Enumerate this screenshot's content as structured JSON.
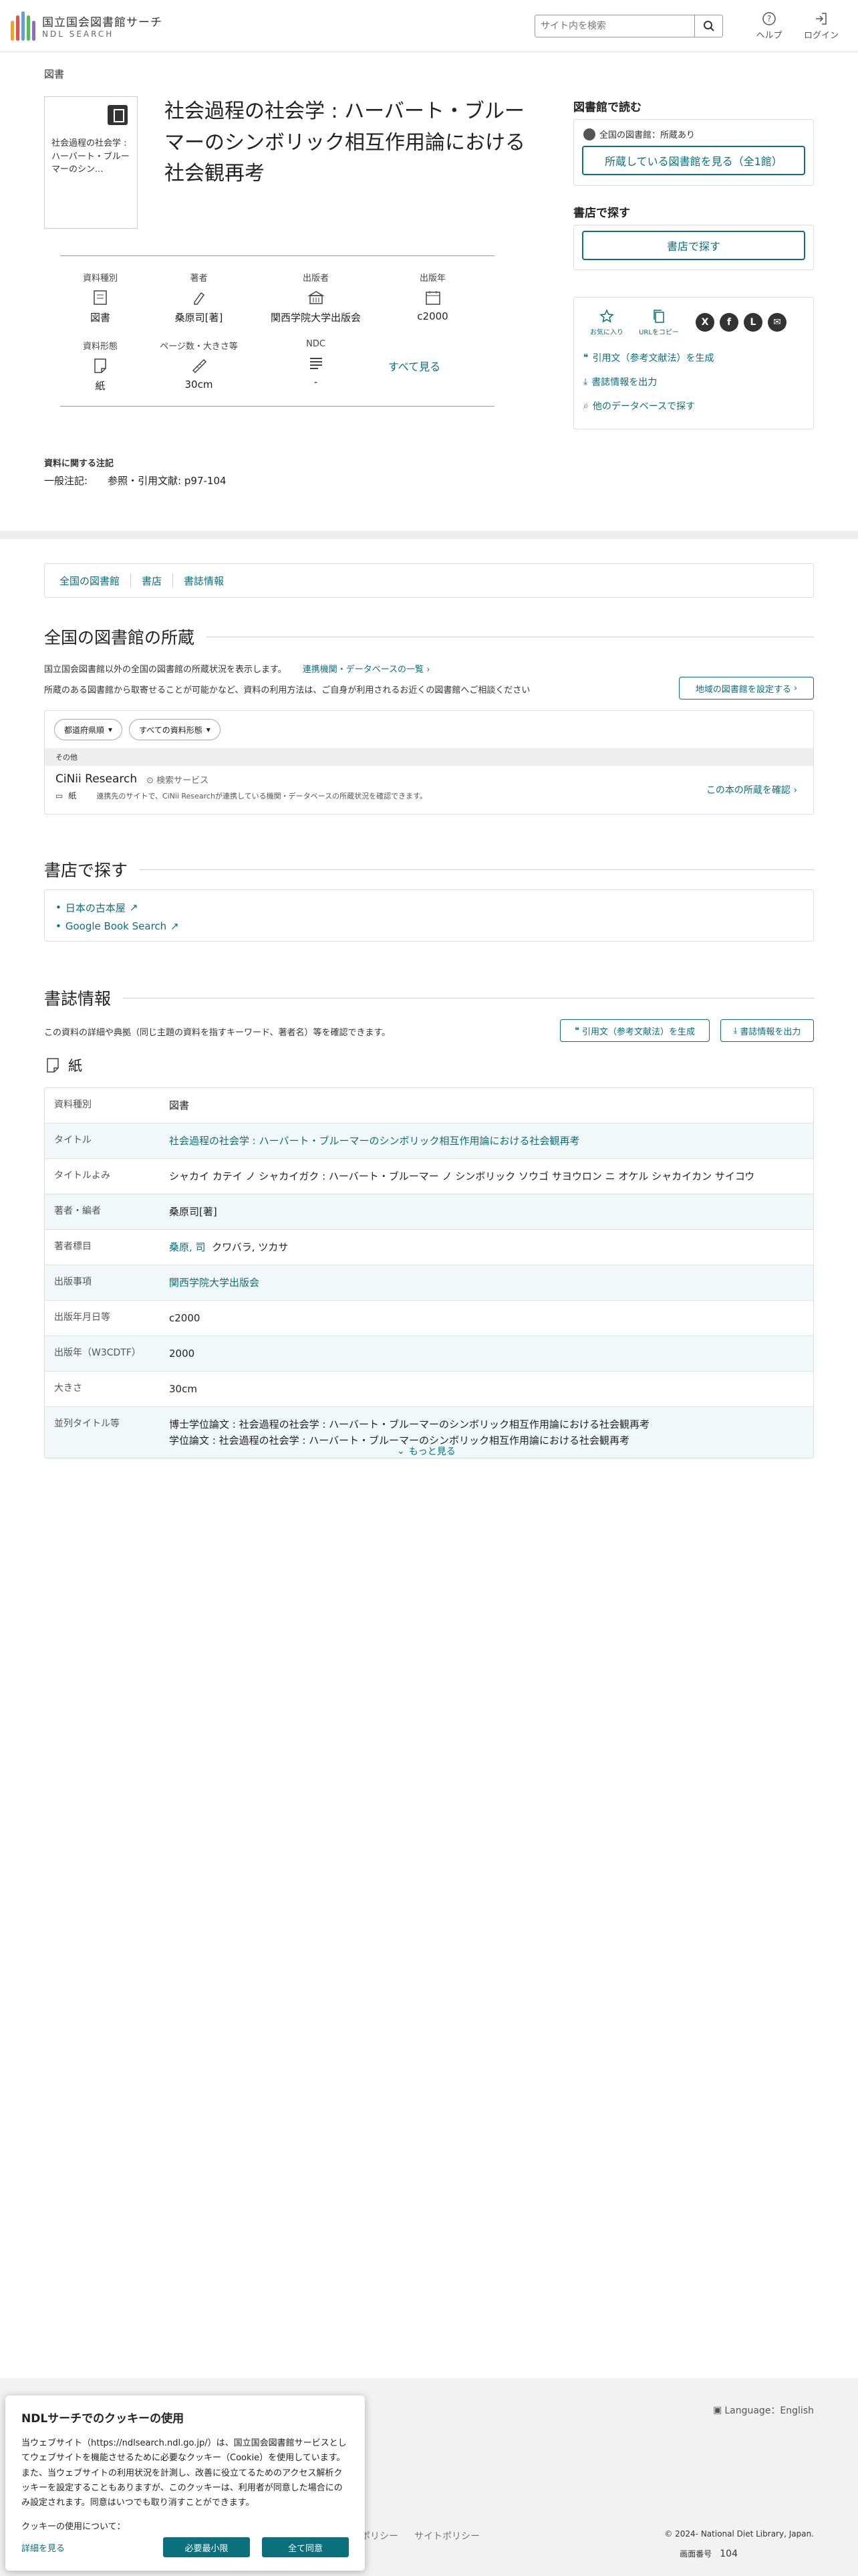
{
  "header": {
    "logo_ja": "国立国会図書館サーチ",
    "logo_en": "NDL SEARCH",
    "search_placeholder": "サイト内を検索",
    "help": "ヘルプ",
    "login": "ログイン"
  },
  "breadcrumb": "図書",
  "book": {
    "thumb_text": "社会過程の社会学 : ハーバート・ブルーマーのシン...",
    "title": "社会過程の社会学 : ハーバート・ブルーマーのシンボリック相互作用論における社会観再考"
  },
  "meta": {
    "type_label": "資料種別",
    "type_value": "図書",
    "author_label": "著者",
    "author_value": "桑原司[著]",
    "publisher_label": "出版者",
    "publisher_value": "関西学院大学出版会",
    "year_label": "出版年",
    "year_value": "c2000",
    "form_label": "資料形態",
    "form_value": "紙",
    "pages_label": "ページ数・大きさ等",
    "pages_value": "30cm",
    "ndc_label": "NDC",
    "ndc_value": "-",
    "see_all": "すべて見る"
  },
  "note": {
    "heading": "資料に関する注記",
    "key": "一般注記:",
    "value": "参照・引用文献: p97-104"
  },
  "sidebar": {
    "read_heading": "図書館で読む",
    "holding": "全国の図書館：所蔵あり",
    "holding_btn": "所蔵している図書館を見る（全1館）",
    "shop_heading": "書店で探す",
    "shop_btn": "書店で探す",
    "favorite": "お気に入り",
    "copy_url": "URLをコピー",
    "cite": "引用文（参考文献法）を生成",
    "export": "書誌情報を出力",
    "other_db": "他のデータベースで探す"
  },
  "tabs": [
    "全国の図書館",
    "書店",
    "書誌情報"
  ],
  "holdings": {
    "heading": "全国の図書館の所蔵",
    "desc1": "国立国会図書館以外の全国の図書館の所蔵状況を表示します。",
    "desc1_link": "連携機関・データベースの一覧",
    "desc2": "所蔵のある図書館から取寄せることが可能かなど、資料の利用方法は、ご自身が利用されるお近くの図書館へご相談ください",
    "region_btn": "地域の図書館を設定する",
    "filter_pref": "都道府県順",
    "filter_type": "すべての資料形態",
    "other": "その他",
    "cinii_name": "CiNii Research",
    "cinii_service": "検索サービス",
    "cinii_form": "紙",
    "cinii_note": "連携先のサイトで、CiNii Researchが連携している機関・データベースの所蔵状況を確認できます。",
    "cinii_check": "この本の所蔵を確認"
  },
  "shops": {
    "heading": "書店で探す",
    "links": [
      "日本の古本屋",
      "Google Book Search"
    ]
  },
  "biblio": {
    "heading": "書誌情報",
    "desc": "この資料の詳細や典拠（同じ主題の資料を指すキーワード、著者名）等を確認できます。",
    "cite_btn": "引用文（参考文献法）を生成",
    "export_btn": "書誌情報を出力",
    "kind": "紙",
    "rows": [
      {
        "key": "資料種別",
        "value": "図書"
      },
      {
        "key": "タイトル",
        "value": "社会過程の社会学 : ハーバート・ブルーマーのシンボリック相互作用論における社会観再考"
      },
      {
        "key": "タイトルよみ",
        "value": "シャカイ カテイ ノ シャカイガク : ハーバート・ブルーマー ノ シンボリック ソウゴ サヨウロン ニ オケル シャカイカン サイコウ"
      },
      {
        "key": "著者・編者",
        "value": "桑原司[著]"
      },
      {
        "key": "著者標目",
        "value": "桑原, 司",
        "extra": "クワバラ, ツカサ"
      },
      {
        "key": "出版事項",
        "value": "関西学院大学出版会"
      },
      {
        "key": "出版年月日等",
        "value": "c2000"
      },
      {
        "key": "出版年（W3CDTF）",
        "value": "2000"
      },
      {
        "key": "大きさ",
        "value": "30cm"
      },
      {
        "key": "並列タイトル等",
        "value": "博士学位論文 : 社会過程の社会学 : ハーバート・ブルーマーのシンボリック相互作用論における社会観再考",
        "value2": "学位論文 : 社会過程の社会学 : ハーバート・ブルーマーのシンボリック相互作用論における社会観再考"
      }
    ],
    "more": "もっと見る"
  },
  "footer": {
    "language": "Language：English",
    "links": [
      "ポリシー",
      "サイトポリシー"
    ],
    "copyright": "© 2024- National Diet Library, Japan.",
    "screen_label": "画面番号",
    "screen_no": "104"
  },
  "cookie": {
    "title": "NDLサーチでのクッキーの使用",
    "body": "当ウェブサイト（https://ndlsearch.ndl.go.jp/）は、国立国会図書館サービスとしてウェブサイトを機能させるために必要なクッキー（Cookie）を使用しています。また、当ウェブサイトの利用状況を計測し、改善に役立てるためのアクセス解析クッキーを設定することもありますが、このクッキーは、利用者が同意した場合にのみ設定されます。同意はいつでも取り消すことができます。",
    "question": "クッキーの使用について：",
    "detail": "詳細を見る",
    "necessary": "必要最小限",
    "accept": "全て同意"
  },
  "colors": {
    "accent": "#0b6f7c"
  }
}
